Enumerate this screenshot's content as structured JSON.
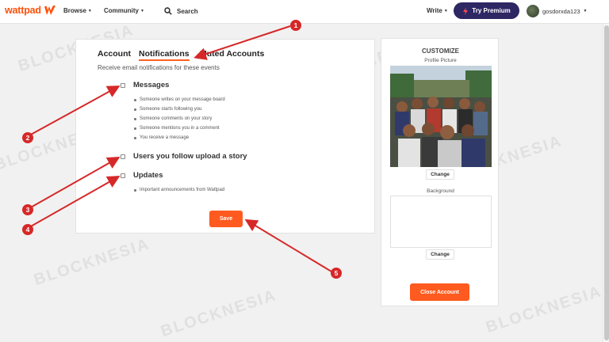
{
  "header": {
    "logo_text": "wattpad",
    "nav_browse": "Browse",
    "nav_community": "Community",
    "search_label": "Search",
    "write_label": "Write",
    "premium_label": "Try Premium",
    "username": "gosdorxda123",
    "colors": {
      "brand": "#ff500a",
      "premium_bg": "#2d2763"
    }
  },
  "settings": {
    "tabs": [
      "Account",
      "Notifications",
      "Muted Accounts"
    ],
    "active_tab": "Notifications",
    "subheading": "Receive email notifications for these events",
    "groups": [
      {
        "title": "Messages",
        "checked": false,
        "items": [
          "Someone writes on your message board",
          "Someone starts following you",
          "Someone comments on your story",
          "Someone mentions you in a comment",
          "You receive a message"
        ]
      },
      {
        "title": "Users you follow upload a story",
        "checked": false,
        "items": []
      },
      {
        "title": "Updates",
        "checked": false,
        "items": [
          "Important announcements from Wattpad"
        ]
      }
    ],
    "save_label": "Save"
  },
  "customize": {
    "title": "CUSTOMIZE",
    "profile_picture_label": "Profile Picture",
    "change_label": "Change",
    "background_label": "Background",
    "close_account_label": "Close Account",
    "accent_color": "#ff5a1f"
  },
  "watermark": "BLOCKNESIA",
  "annotations": [
    "1",
    "2",
    "3",
    "4",
    "5"
  ]
}
